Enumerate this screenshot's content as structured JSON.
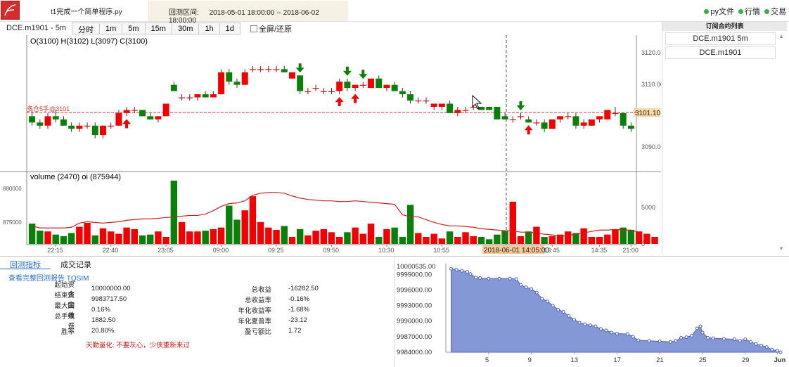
{
  "app": {
    "title": "t1完成一个简单程序.py",
    "range_label": "回测区间:",
    "range_value": "2018-05-01 18:00:00 -- 2018-06-02 18:00:00",
    "links": [
      {
        "label": "py文件",
        "color": "#3cb043"
      },
      {
        "label": "行情",
        "color": "#3cb043"
      },
      {
        "label": "交易",
        "color": "#3cb043"
      }
    ]
  },
  "toolbar": {
    "symbol": "DCE.m1901 - 5m",
    "periods": [
      "分时",
      "1m",
      "5m",
      "15m",
      "30m",
      "1h",
      "1d"
    ],
    "fullscreen_label": "全屏/还原"
  },
  "chart": {
    "ohlc_text": "O(3100) H(3102) L(3097) C(3100)",
    "volume_text": "volume (2470) oi (875944)",
    "price_ticks": [
      "3120.00",
      "3110.00",
      "3100.00",
      "3090.00"
    ],
    "last_price_label": "3101.10",
    "position_label": "多仓5手@3101",
    "volume_ticks_right": [
      "5000",
      "0"
    ],
    "oi_ticks_left": [
      "880000",
      "875000"
    ],
    "x_ticks": [
      "22:15",
      "22:40",
      "23:05",
      "09:00",
      "09:25",
      "09:50",
      "10:30",
      "10:55",
      "11:20",
      "13:45",
      "14:35",
      "21:00"
    ],
    "cursor_time": "2018-06-01 14:05:00",
    "colors": {
      "up": "#f20000",
      "down": "#0a7f0a",
      "oi": "#c32222",
      "cursor_label_bg": "#f7c89a",
      "last_price_bg": "#f7d9a6"
    },
    "chart_data": {
      "type": "candlestick",
      "x_ticks": [
        "22:15",
        "22:40",
        "23:05",
        "09:00",
        "09:25",
        "09:50",
        "10:30",
        "10:55",
        "11:20",
        "13:45",
        "14:35",
        "21:00"
      ],
      "candles": [
        {
          "o": 3100,
          "h": 3102,
          "l": 3097,
          "c": 3098
        },
        {
          "o": 3098,
          "h": 3099,
          "l": 3096,
          "c": 3097
        },
        {
          "o": 3097,
          "h": 3101,
          "l": 3096,
          "c": 3100
        },
        {
          "o": 3100,
          "h": 3102,
          "l": 3098,
          "c": 3099
        },
        {
          "o": 3099,
          "h": 3100,
          "l": 3097,
          "c": 3097
        },
        {
          "o": 3097,
          "h": 3098,
          "l": 3095,
          "c": 3096
        },
        {
          "o": 3096,
          "h": 3098,
          "l": 3095,
          "c": 3097
        },
        {
          "o": 3097,
          "h": 3098,
          "l": 3096,
          "c": 3097
        },
        {
          "o": 3097,
          "h": 3098,
          "l": 3093,
          "c": 3094
        },
        {
          "o": 3094,
          "h": 3097,
          "l": 3093,
          "c": 3097
        },
        {
          "o": 3097,
          "h": 3098,
          "l": 3096,
          "c": 3097
        },
        {
          "o": 3097,
          "h": 3102,
          "l": 3097,
          "c": 3101
        },
        {
          "o": 3101,
          "h": 3103,
          "l": 3100,
          "c": 3102
        },
        {
          "o": 3102,
          "h": 3103,
          "l": 3101,
          "c": 3102
        },
        {
          "o": 3102,
          "h": 3102,
          "l": 3100,
          "c": 3100
        },
        {
          "o": 3100,
          "h": 3101,
          "l": 3099,
          "c": 3099
        },
        {
          "o": 3099,
          "h": 3100,
          "l": 3098,
          "c": 3100
        },
        {
          "o": 3100,
          "h": 3104,
          "l": 3100,
          "c": 3104
        },
        {
          "o": 3110,
          "h": 3111,
          "l": 3108,
          "c": 3108
        },
        {
          "o": 3106,
          "h": 3107,
          "l": 3105,
          "c": 3106
        },
        {
          "o": 3106,
          "h": 3107,
          "l": 3105,
          "c": 3106
        },
        {
          "o": 3106,
          "h": 3107,
          "l": 3105,
          "c": 3107
        },
        {
          "o": 3107,
          "h": 3108,
          "l": 3106,
          "c": 3106
        },
        {
          "o": 3106,
          "h": 3108,
          "l": 3106,
          "c": 3107
        },
        {
          "o": 3107,
          "h": 3115,
          "l": 3107,
          "c": 3114
        },
        {
          "o": 3114,
          "h": 3115,
          "l": 3110,
          "c": 3111
        },
        {
          "o": 3111,
          "h": 3112,
          "l": 3109,
          "c": 3110
        },
        {
          "o": 3110,
          "h": 3115,
          "l": 3110,
          "c": 3114
        },
        {
          "o": 3115,
          "h": 3116,
          "l": 3114,
          "c": 3115
        },
        {
          "o": 3115,
          "h": 3116,
          "l": 3114,
          "c": 3115
        },
        {
          "o": 3115,
          "h": 3116,
          "l": 3114,
          "c": 3115
        },
        {
          "o": 3115,
          "h": 3116,
          "l": 3114,
          "c": 3115
        },
        {
          "o": 3115,
          "h": 3116,
          "l": 3114,
          "c": 3114
        },
        {
          "o": 3112,
          "h": 3114,
          "l": 3112,
          "c": 3114
        },
        {
          "o": 3113,
          "h": 3113,
          "l": 3107,
          "c": 3108
        },
        {
          "o": 3108,
          "h": 3109,
          "l": 3107,
          "c": 3108
        },
        {
          "o": 3109,
          "h": 3110,
          "l": 3108,
          "c": 3109
        },
        {
          "o": 3108,
          "h": 3109,
          "l": 3107,
          "c": 3108
        },
        {
          "o": 3108,
          "h": 3109,
          "l": 3107,
          "c": 3108
        },
        {
          "o": 3108,
          "h": 3112,
          "l": 3107,
          "c": 3111
        },
        {
          "o": 3111,
          "h": 3112,
          "l": 3108,
          "c": 3109
        },
        {
          "o": 3109,
          "h": 3110,
          "l": 3108,
          "c": 3110
        },
        {
          "o": 3110,
          "h": 3111,
          "l": 3109,
          "c": 3110
        },
        {
          "o": 3109,
          "h": 3112,
          "l": 3109,
          "c": 3112
        },
        {
          "o": 3112,
          "h": 3113,
          "l": 3109,
          "c": 3109
        },
        {
          "o": 3109,
          "h": 3110,
          "l": 3108,
          "c": 3110
        },
        {
          "o": 3110,
          "h": 3111,
          "l": 3108,
          "c": 3108
        },
        {
          "o": 3108,
          "h": 3109,
          "l": 3106,
          "c": 3107
        },
        {
          "o": 3107,
          "h": 3108,
          "l": 3104,
          "c": 3105
        },
        {
          "o": 3105,
          "h": 3106,
          "l": 3104,
          "c": 3105
        },
        {
          "o": 3105,
          "h": 3106,
          "l": 3104,
          "c": 3105
        },
        {
          "o": 3103,
          "h": 3104,
          "l": 3102,
          "c": 3104
        },
        {
          "o": 3103,
          "h": 3104,
          "l": 3102,
          "c": 3104
        },
        {
          "o": 3104,
          "h": 3105,
          "l": 3101,
          "c": 3101
        },
        {
          "o": 3101,
          "h": 3103,
          "l": 3100,
          "c": 3102
        },
        {
          "o": 3102,
          "h": 3103,
          "l": 3101,
          "c": 3102
        },
        {
          "o": 3103,
          "h": 3104,
          "l": 3102,
          "c": 3103
        },
        {
          "o": 3103,
          "h": 3103,
          "l": 3102,
          "c": 3102
        },
        {
          "o": 3103,
          "h": 3103,
          "l": 3102,
          "c": 3102
        },
        {
          "o": 3103,
          "h": 3103,
          "l": 3099,
          "c": 3099
        },
        {
          "o": 3100,
          "h": 3101,
          "l": 3099,
          "c": 3099
        },
        {
          "o": 3099,
          "h": 3100,
          "l": 3098,
          "c": 3099
        },
        {
          "o": 3100,
          "h": 3101,
          "l": 3099,
          "c": 3100
        },
        {
          "o": 3099,
          "h": 3100,
          "l": 3098,
          "c": 3098
        },
        {
          "o": 3098,
          "h": 3099,
          "l": 3097,
          "c": 3098
        },
        {
          "o": 3098,
          "h": 3099,
          "l": 3095,
          "c": 3096
        },
        {
          "o": 3096,
          "h": 3099,
          "l": 3096,
          "c": 3099
        },
        {
          "o": 3099,
          "h": 3100,
          "l": 3098,
          "c": 3100
        },
        {
          "o": 3100,
          "h": 3101,
          "l": 3099,
          "c": 3100
        },
        {
          "o": 3100,
          "h": 3101,
          "l": 3096,
          "c": 3097
        },
        {
          "o": 3097,
          "h": 3099,
          "l": 3096,
          "c": 3098
        },
        {
          "o": 3097,
          "h": 3099,
          "l": 3097,
          "c": 3099
        },
        {
          "o": 3099,
          "h": 3100,
          "l": 3098,
          "c": 3100
        },
        {
          "o": 3099,
          "h": 3102,
          "l": 3099,
          "c": 3102
        },
        {
          "o": 3101,
          "h": 3103,
          "l": 3100,
          "c": 3101
        },
        {
          "o": 3101,
          "h": 3101,
          "l": 3096,
          "c": 3097
        },
        {
          "o": 3097,
          "h": 3098,
          "l": 3095,
          "c": 3096
        }
      ],
      "volume_max": 8000,
      "volumes": [
        2600,
        1700,
        1600,
        1200,
        1000,
        1400,
        2200,
        2700,
        1100,
        2000,
        1600,
        1300,
        2100,
        1900,
        1100,
        1200,
        1600,
        900,
        8100,
        2800,
        1600,
        1600,
        1700,
        1900,
        2100,
        4900,
        3100,
        4300,
        6100,
        2800,
        2100,
        1800,
        2300,
        900,
        1900,
        1100,
        1700,
        1900,
        1500,
        900,
        1500,
        2100,
        1300,
        2600,
        900,
        1900,
        2100,
        900,
        5000,
        1400,
        900,
        1300,
        700,
        1600,
        900,
        1500,
        1000,
        900,
        600,
        1200,
        1700,
        5400,
        1000,
        1600,
        2200,
        900,
        1000,
        1200,
        1600,
        1400,
        2000,
        900,
        900,
        1200,
        1800,
        2100,
        1800,
        1600,
        1300,
        900
      ],
      "oi_min": 873000,
      "oi_max": 882000,
      "oi": [
        875600,
        875300,
        875300,
        875300,
        875300,
        875400,
        876000,
        876200,
        876100,
        876000,
        876100,
        876200,
        876400,
        876500,
        876600,
        876600,
        876700,
        876800,
        876900,
        877000,
        877100,
        877100,
        877300,
        877800,
        878400,
        878800,
        878900,
        879200,
        880000,
        880300,
        880400,
        880400,
        880300,
        879900,
        879600,
        879400,
        879300,
        879200,
        879200,
        879100,
        879100,
        879200,
        879100,
        879000,
        878900,
        878800,
        878700,
        877200,
        876900,
        876900,
        876500,
        876100,
        875800,
        875600,
        875600,
        875500,
        875400,
        875200,
        875100,
        875000,
        874900,
        874900,
        874700,
        874700,
        874600,
        874400,
        874300,
        874100,
        874200,
        874400,
        874600,
        874800,
        875000,
        875000,
        875100,
        875000,
        875000,
        874700
      ],
      "signals": [
        {
          "i": 12,
          "dir": "up"
        },
        {
          "i": 34,
          "dir": "down"
        },
        {
          "i": 39,
          "dir": "up"
        },
        {
          "i": 40,
          "dir": "down"
        },
        {
          "i": 41,
          "dir": "up"
        },
        {
          "i": 42,
          "dir": "down"
        },
        {
          "i": 62,
          "dir": "down"
        },
        {
          "i": 63,
          "dir": "up"
        }
      ]
    }
  },
  "sidebar": {
    "title": "订阅合约列表",
    "items": [
      "DCE.m1901 5m",
      "DCE.m1901"
    ]
  },
  "bottom": {
    "tabs": [
      "回测指标",
      "成交记录"
    ],
    "report_link": "查看完整回测报告 TQSIM",
    "left_metrics": [
      {
        "label": "起始资金",
        "value": "10000000.00"
      },
      {
        "label": "结束资金",
        "value": "9983717.50"
      },
      {
        "label": "最大回撤",
        "value": "0.16%"
      },
      {
        "label": "总手续费",
        "value": "1882.50"
      },
      {
        "label": "胜率",
        "value": "20.80%"
      }
    ],
    "right_metrics": [
      {
        "label": "总收益",
        "value": "-16282.50"
      },
      {
        "label": "总收益率",
        "value": "-0.16%"
      },
      {
        "label": "年化收益率",
        "value": "-1.68%"
      },
      {
        "label": "年化夏普率",
        "value": "-23.12"
      },
      {
        "label": "盈亏额比",
        "value": "1.72"
      }
    ],
    "note": "天勤量化: 不要灰心，少侠重新来过"
  },
  "equity": {
    "chart_data": {
      "type": "area",
      "y_ticks": [
        "10000535.00",
        "9999000.00",
        "9996000.00",
        "9993000.00",
        "9990000.00",
        "9987000.00",
        "9984000.00"
      ],
      "ylim": [
        9984000,
        10000535
      ],
      "x_ticks": [
        "5",
        "9",
        "13",
        "17",
        "21",
        "25",
        "29",
        "Jun"
      ],
      "x_days": [
        5,
        9,
        13,
        17,
        21,
        25,
        29,
        32
      ],
      "xlim": [
        1,
        32.3
      ],
      "color": "#6f86cf",
      "points": [
        [
          1.5,
          10000100
        ],
        [
          2.0,
          9999900
        ],
        [
          2.5,
          9999700
        ],
        [
          3.0,
          9999500
        ],
        [
          3.3,
          9999100
        ],
        [
          3.8,
          9998400
        ],
        [
          4.2,
          9998300
        ],
        [
          5.0,
          9998200
        ],
        [
          6.0,
          9998200
        ],
        [
          7.0,
          9998200
        ],
        [
          7.6,
          9998100
        ],
        [
          8.0,
          9997000
        ],
        [
          8.5,
          9996500
        ],
        [
          9.0,
          9996200
        ],
        [
          9.5,
          9995500
        ],
        [
          10.0,
          9994300
        ],
        [
          10.5,
          9993800
        ],
        [
          11.0,
          9993000
        ],
        [
          11.5,
          9992200
        ],
        [
          12.0,
          9991800
        ],
        [
          12.5,
          9991000
        ],
        [
          13.0,
          9990300
        ],
        [
          13.5,
          9989700
        ],
        [
          14.0,
          9989400
        ],
        [
          14.5,
          9989200
        ],
        [
          15.0,
          9989000
        ],
        [
          15.5,
          9988500
        ],
        [
          16.0,
          9988200
        ],
        [
          16.5,
          9987800
        ],
        [
          17.0,
          9987600
        ],
        [
          18.0,
          9987500
        ],
        [
          18.5,
          9987000
        ],
        [
          19.0,
          9986300
        ],
        [
          20.0,
          9986200
        ],
        [
          21.0,
          9986100
        ],
        [
          22.0,
          9986000
        ],
        [
          22.5,
          9986200
        ],
        [
          23.0,
          9986800
        ],
        [
          23.5,
          9986900
        ],
        [
          24.0,
          9987200
        ],
        [
          24.5,
          9988600
        ],
        [
          24.8,
          9989000
        ],
        [
          25.0,
          9987800
        ],
        [
          25.5,
          9986800
        ],
        [
          26.0,
          9986700
        ],
        [
          27.0,
          9986600
        ],
        [
          28.0,
          9986500
        ],
        [
          28.5,
          9986200
        ],
        [
          29.0,
          9986500
        ],
        [
          29.5,
          9986000
        ],
        [
          30.0,
          9985600
        ],
        [
          30.5,
          9985300
        ],
        [
          31.0,
          9985000
        ],
        [
          31.5,
          9984500
        ],
        [
          32.0,
          9984300
        ],
        [
          32.3,
          9984000
        ]
      ]
    }
  }
}
